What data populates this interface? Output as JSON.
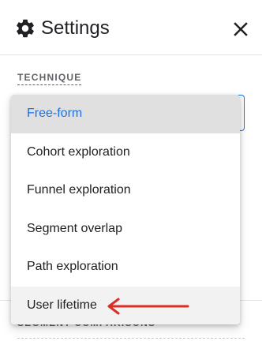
{
  "header": {
    "title": "Settings",
    "settings_icon": "gear-icon",
    "close_icon": "close-icon"
  },
  "technique": {
    "label": "TECHNIQUE",
    "selected": "Free-form"
  },
  "menu": {
    "items": [
      {
        "label": "Free-form"
      },
      {
        "label": "Cohort exploration"
      },
      {
        "label": "Funnel exploration"
      },
      {
        "label": "Segment overlap"
      },
      {
        "label": "Path exploration"
      },
      {
        "label": "User lifetime"
      }
    ]
  },
  "segment_comparisons": {
    "label": "SEGMENT COMPARISONS"
  },
  "colors": {
    "accent": "#1a73e8",
    "annotation_arrow": "#d93025",
    "selected_bg": "#e0e0e0"
  }
}
